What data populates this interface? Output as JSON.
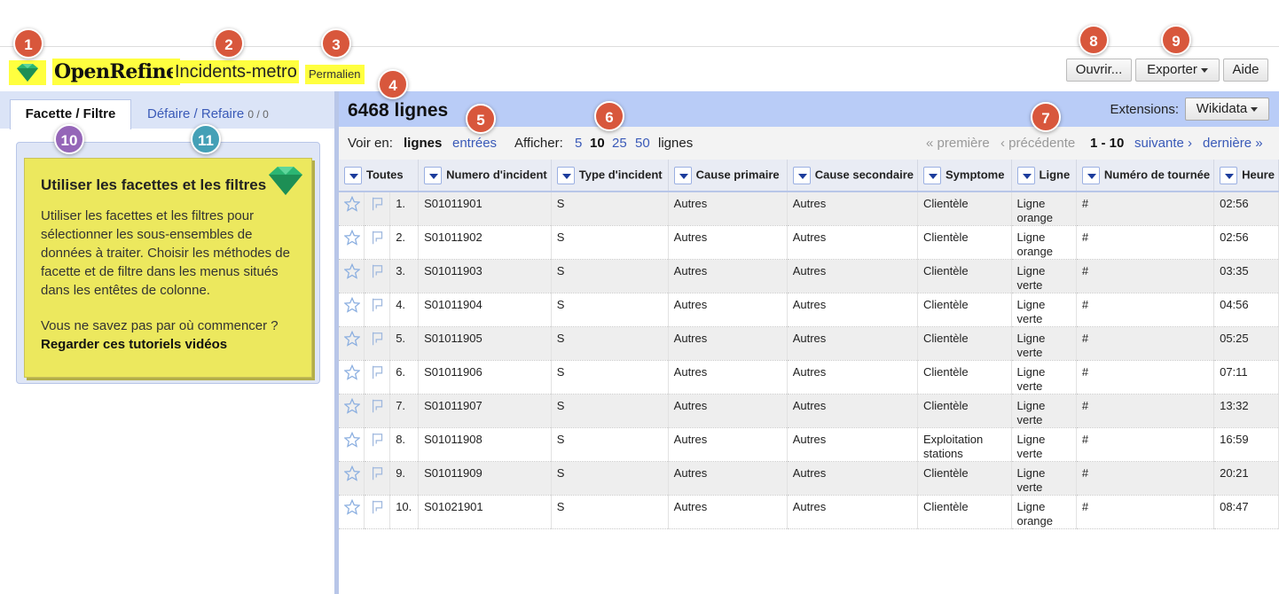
{
  "header": {
    "brand": "OpenRefine",
    "project_name": "Incidents-metro",
    "permalink": "Permalien",
    "open_button": "Ouvrir...",
    "export_button": "Exporter",
    "help_button": "Aide"
  },
  "markers": [
    "1",
    "2",
    "3",
    "4",
    "5",
    "6",
    "7",
    "8",
    "9",
    "10",
    "11"
  ],
  "left_panel": {
    "tab_facet": "Facette / Filtre",
    "tab_undo": "Défaire / Refaire",
    "undo_count": "0 / 0",
    "card_title": "Utiliser les facettes et les filtres",
    "card_text": "Utiliser les facettes et les filtres pour sélectionner les sous-ensembles de données à traiter. Choisir les méthodes de facette et de filtre dans les menus situés dans les entêtes de colonne.",
    "card_question": "Vous ne savez pas par où commencer ?",
    "card_link": "Regarder ces tutoriels vidéos"
  },
  "grid_header": {
    "row_count": "6468 lignes",
    "extensions_label": "Extensions:",
    "extensions_button": "Wikidata"
  },
  "view_bar": {
    "view_label": "Voir en:",
    "mode_rows": "lignes",
    "mode_records": "entrées",
    "show_label": "Afficher:",
    "page_sizes": [
      "5",
      "10",
      "25",
      "50"
    ],
    "page_size_suffix": "lignes",
    "first": "« première",
    "previous": "‹ précédente",
    "range": "1 - 10",
    "next": "suivante ›",
    "last": "dernière »"
  },
  "columns": [
    "Toutes",
    "Numero d'incident",
    "Type d'incident",
    "Cause primaire",
    "Cause secondaire",
    "Symptome",
    "Ligne",
    "Numéro de tournée",
    "Heure"
  ],
  "rows": [
    {
      "n": "1.",
      "id": "S01011901",
      "type": "S",
      "cause1": "Autres",
      "cause2": "Autres",
      "symptome": "Clientèle",
      "ligne1": "Ligne",
      "ligne2": "orange",
      "tournee": "#",
      "heure": "02:56"
    },
    {
      "n": "2.",
      "id": "S01011902",
      "type": "S",
      "cause1": "Autres",
      "cause2": "Autres",
      "symptome": "Clientèle",
      "ligne1": "Ligne",
      "ligne2": "orange",
      "tournee": "#",
      "heure": "02:56"
    },
    {
      "n": "3.",
      "id": "S01011903",
      "type": "S",
      "cause1": "Autres",
      "cause2": "Autres",
      "symptome": "Clientèle",
      "ligne1": "Ligne",
      "ligne2": "verte",
      "tournee": "#",
      "heure": "03:35"
    },
    {
      "n": "4.",
      "id": "S01011904",
      "type": "S",
      "cause1": "Autres",
      "cause2": "Autres",
      "symptome": "Clientèle",
      "ligne1": "Ligne",
      "ligne2": "verte",
      "tournee": "#",
      "heure": "04:56"
    },
    {
      "n": "5.",
      "id": "S01011905",
      "type": "S",
      "cause1": "Autres",
      "cause2": "Autres",
      "symptome": "Clientèle",
      "ligne1": "Ligne",
      "ligne2": "verte",
      "tournee": "#",
      "heure": "05:25"
    },
    {
      "n": "6.",
      "id": "S01011906",
      "type": "S",
      "cause1": "Autres",
      "cause2": "Autres",
      "symptome": "Clientèle",
      "ligne1": "Ligne",
      "ligne2": "verte",
      "tournee": "#",
      "heure": "07:11"
    },
    {
      "n": "7.",
      "id": "S01011907",
      "type": "S",
      "cause1": "Autres",
      "cause2": "Autres",
      "symptome": "Clientèle",
      "ligne1": "Ligne",
      "ligne2": "verte",
      "tournee": "#",
      "heure": "13:32"
    },
    {
      "n": "8.",
      "id": "S01011908",
      "type": "S",
      "cause1": "Autres",
      "cause2": "Autres",
      "symptome": "Exploitation stations",
      "ligne1": "Ligne",
      "ligne2": "verte",
      "tournee": "#",
      "heure": "16:59"
    },
    {
      "n": "9.",
      "id": "S01011909",
      "type": "S",
      "cause1": "Autres",
      "cause2": "Autres",
      "symptome": "Clientèle",
      "ligne1": "Ligne",
      "ligne2": "verte",
      "tournee": "#",
      "heure": "20:21"
    },
    {
      "n": "10.",
      "id": "S01021901",
      "type": "S",
      "cause1": "Autres",
      "cause2": "Autres",
      "symptome": "Clientèle",
      "ligne1": "Ligne",
      "ligne2": "orange",
      "tournee": "#",
      "heure": "08:47"
    }
  ],
  "icons": {
    "logo": "gem-icon",
    "star": "star-icon",
    "flag": "flag-icon",
    "dropdown": "chevron-down-icon"
  },
  "colors": {
    "highlight": "#ffff3f",
    "marker_red": "#d8573c",
    "marker_purple": "#9566b8",
    "marker_teal": "#44a0b6",
    "header_blue": "#b9ccf7",
    "card_yellow": "#ece85e"
  }
}
